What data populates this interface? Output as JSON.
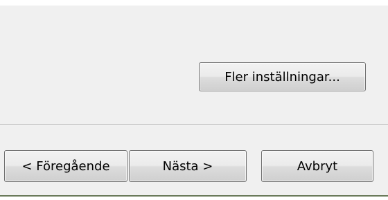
{
  "dialog": {
    "more_settings_label": "Fler inställningar...",
    "buttons": {
      "previous_label": "< Föregående",
      "next_label": "Nästa >",
      "cancel_label": "Avbryt"
    }
  }
}
